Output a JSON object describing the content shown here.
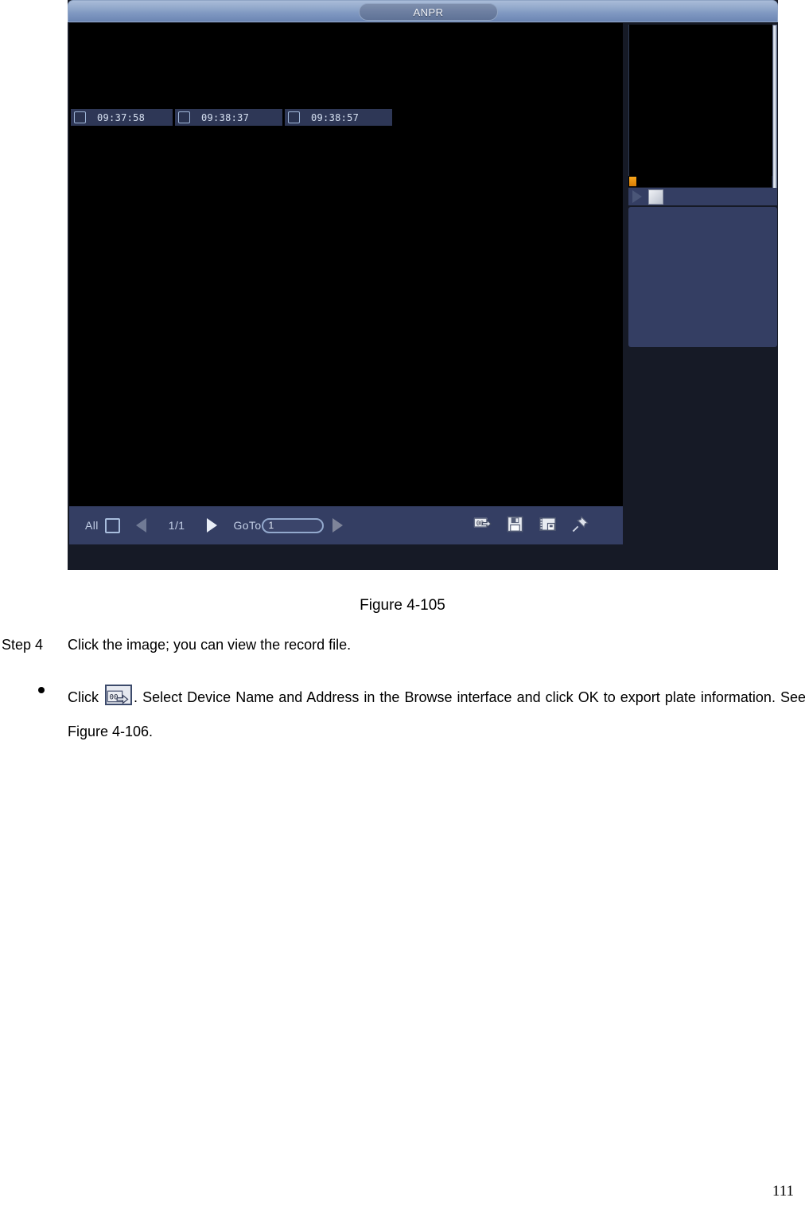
{
  "figure": {
    "window_title": "ANPR",
    "timestamps": [
      {
        "time": "09:37:58",
        "checked": false
      },
      {
        "time": "09:38:37",
        "checked": false
      },
      {
        "time": "09:38:57",
        "checked": false
      }
    ],
    "toolbar": {
      "all_label": "All",
      "all_checked": false,
      "prev_page_icon": "triangle-left-icon",
      "page_indicator": "1/1",
      "next_page_icon": "triangle-right-icon",
      "goto_label": "GoTo",
      "goto_value": "1",
      "goto_go_icon": "triangle-right-icon",
      "icons": [
        {
          "name": "export-plate-icon",
          "title": "Export plate information"
        },
        {
          "name": "save-floppy-icon",
          "title": "Save"
        },
        {
          "name": "save-video-icon",
          "title": "Save video"
        },
        {
          "name": "pin-icon",
          "title": "Pin"
        }
      ]
    },
    "right_panel": {
      "play_icon": "play-icon",
      "stop_icon": "stop-icon",
      "timeline_marker_color": "#f7a51c"
    },
    "colors": {
      "titlebar_top": "#a9bcd8",
      "titlebar_bottom": "#6b85b3",
      "panel_blue": "#343e63",
      "chip_blue": "#2e3756",
      "window_dark": "#161a26",
      "marker_orange": "#f7a51c"
    }
  },
  "document": {
    "caption": "Figure 4-105",
    "step_label": "Step 4",
    "step_text": "Click the image; you can view the record file.",
    "bullet_prefix": "Click",
    "bullet_icon_name": "export-plate-icon",
    "bullet_rest": ". Select Device Name and Address in the Browse interface and click OK to export plate information. See Figure 4-106.",
    "page_number": "111"
  }
}
